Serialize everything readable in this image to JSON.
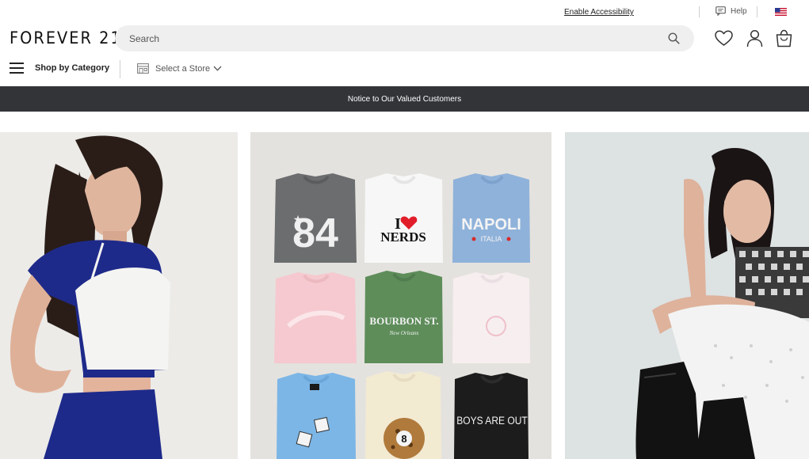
{
  "utility": {
    "accessibility_link": "Enable Accessibility",
    "help_label": "Help",
    "flag_icon": "us-flag-icon"
  },
  "header": {
    "logo_text": "FOREVER 21",
    "search_placeholder": "Search",
    "icons": [
      "heart-icon",
      "account-icon",
      "shopping-bag-icon"
    ]
  },
  "nav": {
    "menu_label": "Shop by Category",
    "store_label": "Select a Store"
  },
  "banner": {
    "text": "Notice to Our Valued Customers"
  },
  "hero": {
    "tees": [
      {
        "print": "84",
        "color": "#6b6d6f"
      },
      {
        "print": "I ♥ NERDS",
        "color": "#f7f7f7"
      },
      {
        "print": "NAPOLI ITALIA",
        "color": "#8fb2da"
      },
      {
        "print": "",
        "color": "#f5c9cf"
      },
      {
        "print": "BOURBON ST. New Orleans",
        "color": "#5e8d5a"
      },
      {
        "print": "",
        "color": "#f7eef0"
      },
      {
        "print": "",
        "color": "#7cb6e6"
      },
      {
        "print": "8",
        "color": "#f3ead2"
      },
      {
        "print": "BOYS ARE OUT",
        "color": "#1c1c1c"
      }
    ],
    "colors": {
      "left_bg": "#ecebe8",
      "center_bg": "#e4e2de",
      "right_bg": "#dde2e3",
      "navy": "#1e2a8a"
    }
  }
}
